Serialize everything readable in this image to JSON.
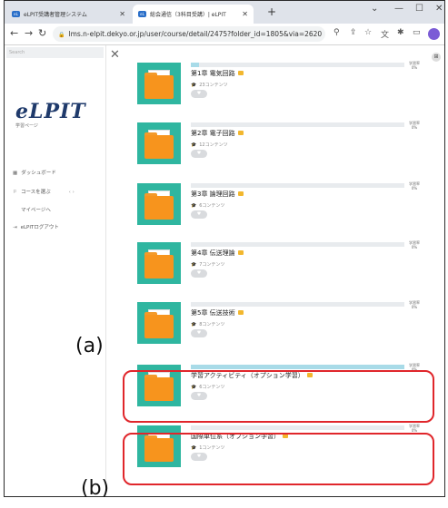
{
  "browser": {
    "tabs": [
      {
        "label": "eLPIT受講者管理システム"
      },
      {
        "label": "総会通信（3科目受講）| eLPIT"
      }
    ],
    "url": "lms.n-elpit.dekyo.or.jp/user/course/detail/2475?folder_id=1805&via=2620"
  },
  "sidebar": {
    "search_placeholder": "Search",
    "logo": "eLPIT",
    "logo_sub": "学習ページ",
    "items": [
      {
        "label": "ダッシュボード"
      },
      {
        "label": "コースを選ぶ"
      },
      {
        "label": "マイページへ"
      },
      {
        "label": "eLPITログアウト"
      }
    ],
    "pager": "‹ ›"
  },
  "cards": [
    {
      "title": "第1章 電気回路",
      "count": "23コンテンツ",
      "progress": 0.04,
      "progress_label": "学習率",
      "progress_pct": "0%"
    },
    {
      "title": "第2章 電子回路",
      "count": "12コンテンツ",
      "progress": 0,
      "progress_label": "学習率",
      "progress_pct": "0%"
    },
    {
      "title": "第3章 論理回路",
      "count": "6コンテンツ",
      "progress": 0,
      "progress_label": "学習率",
      "progress_pct": "0%"
    },
    {
      "title": "第4章 伝送理論",
      "count": "7コンテンツ",
      "progress": 0,
      "progress_label": "学習率",
      "progress_pct": "0%"
    },
    {
      "title": "第5章 伝送技術",
      "count": "8コンテンツ",
      "progress": 0,
      "progress_label": "学習率",
      "progress_pct": "0%"
    },
    {
      "title": "学習アクティビティ（オプション学習）",
      "count": "6コンテンツ",
      "progress": 1.0,
      "progress_label": "学習率",
      "progress_pct": "0%"
    },
    {
      "title": "国際単位系（オプション学習）",
      "count": "1コンテンツ",
      "progress": 0,
      "progress_label": "学習率",
      "progress_pct": "0%"
    }
  ],
  "annotations": {
    "a": "(a)",
    "b": "(b)"
  },
  "colors": {
    "highlight": "#e0262b",
    "thumb": "#2fb6a0",
    "folder": "#f7941d",
    "progress_fill": "#a8dbe8"
  }
}
